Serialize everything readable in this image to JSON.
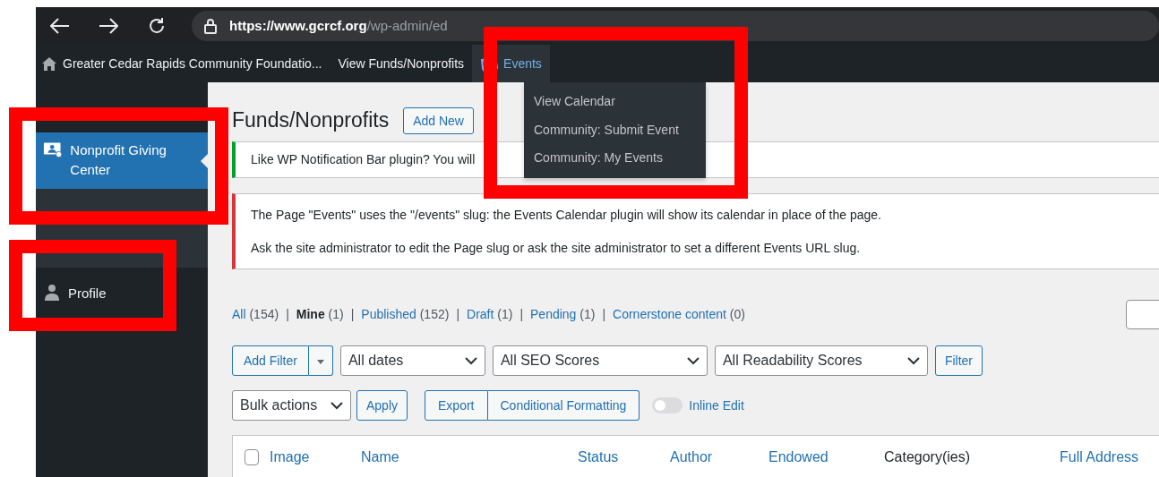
{
  "browser": {
    "url_host": "https://www.gcrcf.org",
    "url_path": "/wp-admin/ed"
  },
  "admin_bar": {
    "items": [
      {
        "label": "Greater Cedar Rapids Community Foundatio...",
        "kind": "home",
        "selected": false
      },
      {
        "label": "View Funds/Nonprofits",
        "kind": "text",
        "selected": false
      },
      {
        "label": "Events",
        "kind": "events",
        "selected": true
      }
    ]
  },
  "events_menu": [
    "View Calendar",
    "Community: Submit Event",
    "Community: My Events"
  ],
  "sidebar": {
    "items": [
      {
        "label": "Nonprofit Giving Center",
        "kind": "giving",
        "selected": true
      },
      {
        "label": "Profile",
        "kind": "profile",
        "selected": false
      }
    ]
  },
  "page": {
    "title": "Funds/Nonprofits",
    "add_button": "Add New"
  },
  "notices": [
    {
      "kind": "success",
      "lines": [
        "Like WP Notification Bar plugin? You will"
      ]
    },
    {
      "kind": "error",
      "lines": [
        "The Page \"Events\" uses the \"/events\" slug: the Events Calendar plugin will show its calendar in place of the page.",
        "Ask the site administrator to edit the Page slug or ask the site administrator to set a different Events URL slug."
      ]
    }
  ],
  "views_separator": "|",
  "views": [
    {
      "label": "All",
      "count": "(154)",
      "selected": false
    },
    {
      "label": "Mine",
      "count": "(1)",
      "selected": true
    },
    {
      "label": "Published",
      "count": "(152)",
      "selected": false
    },
    {
      "label": "Draft",
      "count": "(1)",
      "selected": false
    },
    {
      "label": "Pending",
      "count": "(1)",
      "selected": false
    },
    {
      "label": "Cornerstone content",
      "count": "(0)",
      "selected": false
    }
  ],
  "filters": {
    "add_filter": "Add Filter",
    "selects": [
      "All dates",
      "All SEO Scores",
      "All Readability Scores"
    ],
    "button": "Filter"
  },
  "bulk": {
    "select": "Bulk actions",
    "apply": "Apply",
    "export": "Export",
    "conditional": "Conditional Formatting",
    "inline_edit": {
      "label": "Inline Edit",
      "on": false
    }
  },
  "table": {
    "select_all_checked": false,
    "columns": [
      {
        "label": "Image",
        "sortable": true
      },
      {
        "label": "Name",
        "sortable": true
      },
      {
        "label": "Status",
        "sortable": true
      },
      {
        "label": "Author",
        "sortable": true
      },
      {
        "label": "Endowed",
        "sortable": true
      },
      {
        "label": "Category(ies)",
        "sortable": false
      },
      {
        "label": "Full Address",
        "sortable": true
      }
    ]
  }
}
